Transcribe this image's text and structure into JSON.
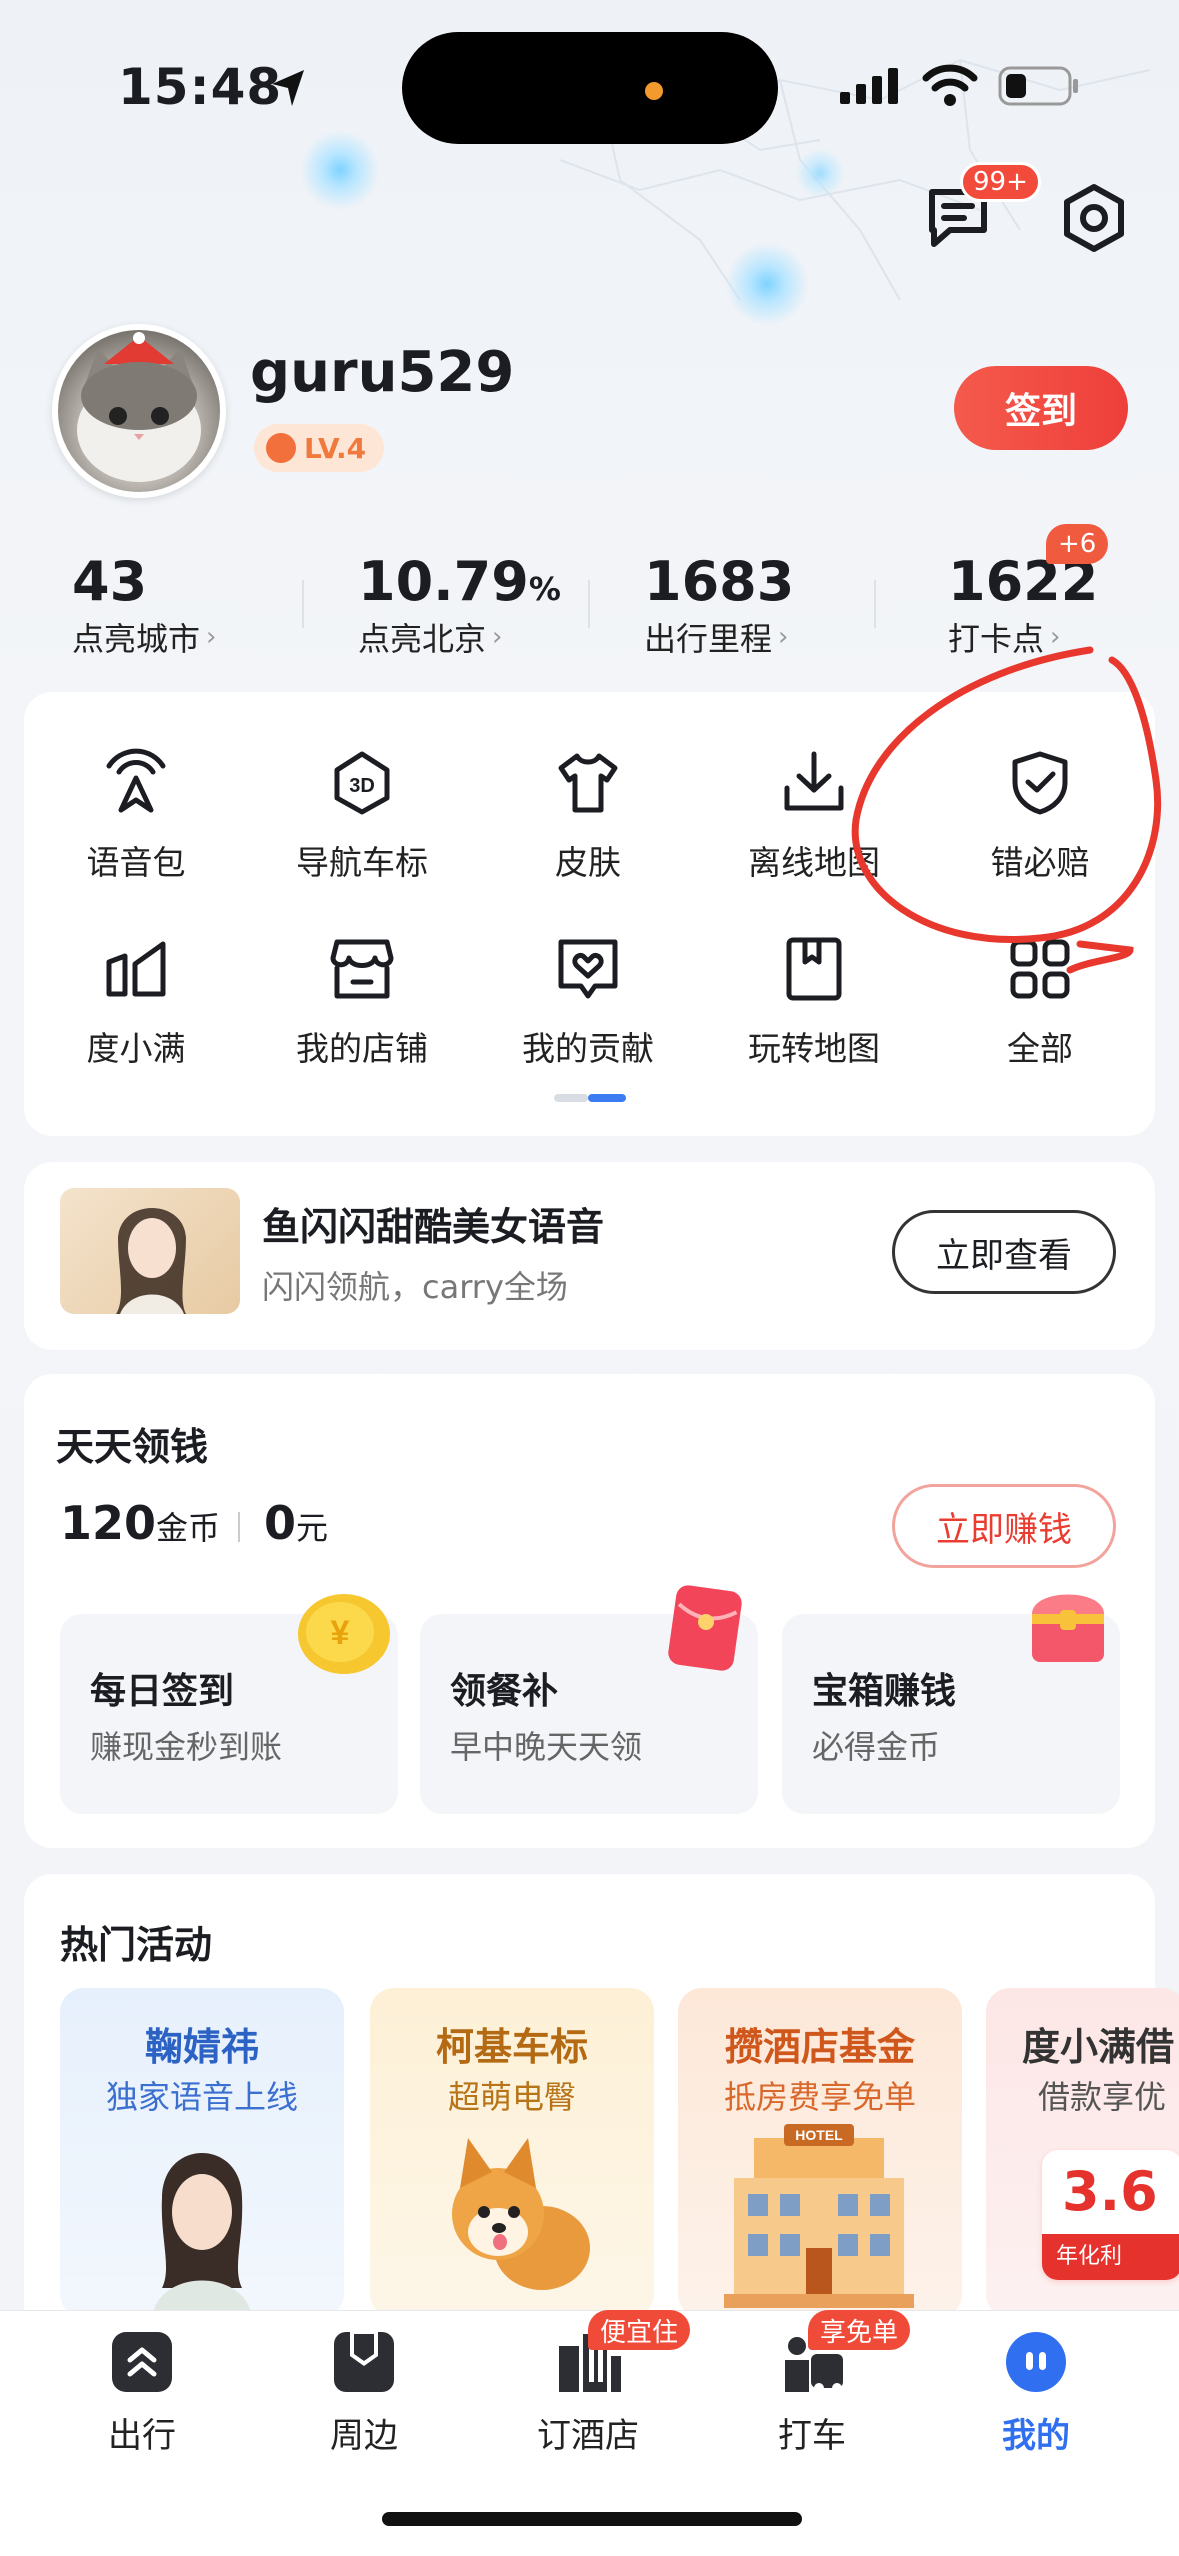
{
  "status": {
    "time": "15:48"
  },
  "header": {
    "msg_badge": "99+"
  },
  "profile": {
    "username": "guru529",
    "level": "LV.4",
    "signin_label": "签到"
  },
  "stats": [
    {
      "value": "43",
      "unit": "",
      "label": "点亮城市"
    },
    {
      "value": "10.79",
      "unit": "%",
      "label": "点亮北京"
    },
    {
      "value": "1683",
      "unit": "",
      "label": "出行里程"
    },
    {
      "value": "1622",
      "unit": "",
      "label": "打卡点",
      "badge": "+6"
    }
  ],
  "tools": [
    {
      "label": "语音包",
      "icon": "voice-pack-icon"
    },
    {
      "label": "导航车标",
      "icon": "3d-car-icon"
    },
    {
      "label": "皮肤",
      "icon": "tshirt-icon"
    },
    {
      "label": "离线地图",
      "icon": "download-icon"
    },
    {
      "label": "错必赔",
      "icon": "shield-check-icon"
    },
    {
      "label": "度小满",
      "icon": "duxiaoman-icon"
    },
    {
      "label": "我的店铺",
      "icon": "store-icon"
    },
    {
      "label": "我的贡献",
      "icon": "contribution-icon"
    },
    {
      "label": "玩转地图",
      "icon": "bookmark-icon"
    },
    {
      "label": "全部",
      "icon": "grid-icon"
    }
  ],
  "promo": {
    "title": "鱼闪闪甜酷美女语音",
    "subtitle": "闪闪领航，carry全场",
    "button": "立即查看"
  },
  "earn": {
    "title": "天天领钱",
    "coins": "120",
    "coins_unit": "金币",
    "money": "0",
    "money_unit": "元",
    "button": "立即赚钱",
    "tasks": [
      {
        "title": "每日签到",
        "subtitle": "赚现金秒到账"
      },
      {
        "title": "领餐补",
        "subtitle": "早中晚天天领"
      },
      {
        "title": "宝箱赚钱",
        "subtitle": "必得金币"
      }
    ]
  },
  "activities": {
    "title": "热门活动",
    "items": [
      {
        "title": "鞠婧祎",
        "subtitle": "独家语音上线"
      },
      {
        "title": "柯基车标",
        "subtitle": "超萌电臀"
      },
      {
        "title": "攒酒店基金",
        "subtitle": "抵房费享免单",
        "hotel_sign": "HOTEL"
      },
      {
        "title": "度小满借",
        "subtitle": "借款享优",
        "figure": "3.6",
        "note": "年化利"
      }
    ]
  },
  "tabbar": [
    {
      "label": "出行",
      "icon": "travel-icon"
    },
    {
      "label": "周边",
      "icon": "nearby-icon"
    },
    {
      "label": "订酒店",
      "icon": "hotel-icon",
      "badge": "便宜住"
    },
    {
      "label": "打车",
      "icon": "taxi-icon",
      "badge": "享免单"
    },
    {
      "label": "我的",
      "icon": "profile-icon",
      "active": true
    }
  ],
  "colors": {
    "accent": "#ee3f3a",
    "active_tab": "#2f6ff0",
    "annotation": "#e8382e"
  }
}
